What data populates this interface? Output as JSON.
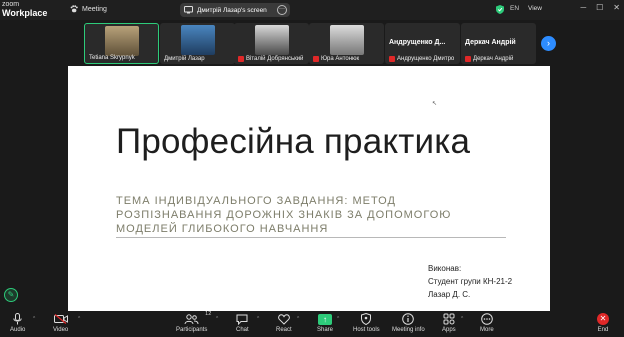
{
  "app": {
    "logo_top": "zoom",
    "logo_bottom": "Workplace",
    "meeting_label": "Meeting"
  },
  "screen_share": {
    "label": "Дмитрій Лазар's screen"
  },
  "top_right": {
    "lang": "EN",
    "view": "View"
  },
  "participants": [
    {
      "name": "Tetiana Skrypnyk",
      "muted": false,
      "video": true
    },
    {
      "name": "Дмитрій Лазар",
      "muted": false,
      "video": true
    },
    {
      "name": "Віталій Добрянський",
      "muted": true,
      "video": true
    },
    {
      "name": "Юра Антонюк",
      "muted": true,
      "video": true
    },
    {
      "name": "Андрущенко Дмитро",
      "display": "Андрущенко Д...",
      "muted": true,
      "video": false
    },
    {
      "name": "Деркач Андрій",
      "display": "Деркач Андрій",
      "muted": true,
      "video": false
    }
  ],
  "slide": {
    "title": "Професійна практика",
    "subtitle": "ТЕМА ІНДИВІДУАЛЬНОГО ЗАВДАННЯ: МЕТОД РОЗПІЗНАВАННЯ ДОРОЖНІХ ЗНАКІВ ЗА ДОПОМОГОЮ МОДЕЛЕЙ ГЛИБОКОГО НАВЧАННЯ",
    "author_line1": "Виконав:",
    "author_line2": "Студент групи КН-21-2",
    "author_line3": "Лазар Д. С."
  },
  "toolbar": {
    "audio": "Audio",
    "video": "Video",
    "participants": "Participants",
    "participants_count": "12",
    "chat": "Chat",
    "react": "React",
    "share": "Share",
    "host_tools": "Host tools",
    "meeting_info": "Meeting info",
    "apps": "Apps",
    "more": "More",
    "end": "End"
  },
  "colors": {
    "accent_green": "#2dcb7a",
    "end_red": "#e02828",
    "nav_blue": "#2d8cff"
  }
}
